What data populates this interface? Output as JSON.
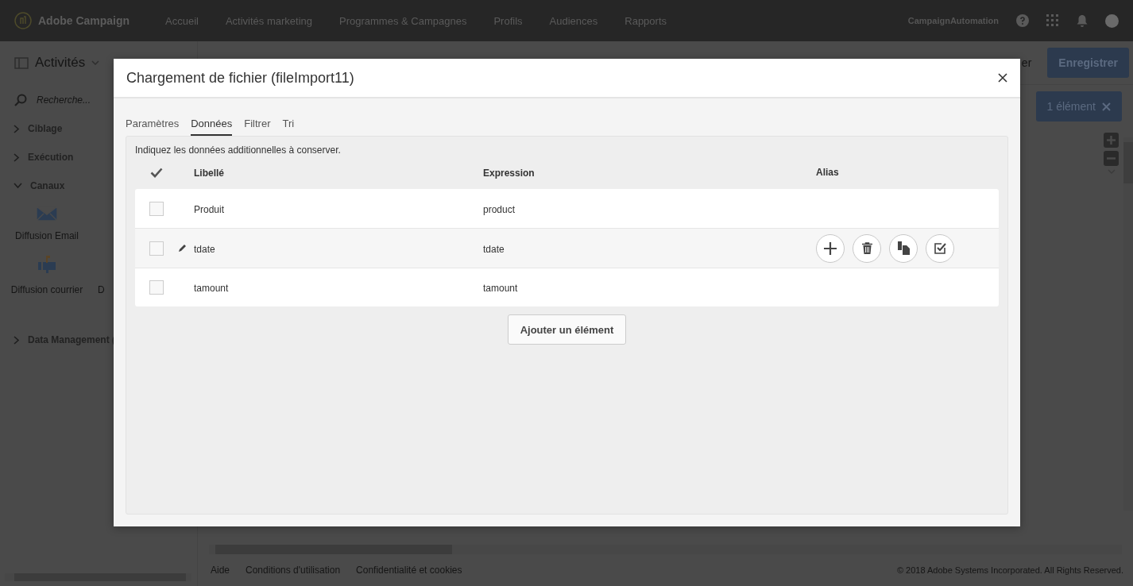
{
  "topbar": {
    "brand": "Adobe Campaign",
    "nav": [
      "Accueil",
      "Activités marketing",
      "Programmes & Campagnes",
      "Profils",
      "Audiences",
      "Rapports"
    ],
    "user": "CampaignAutomation"
  },
  "toolbar": {
    "title": "Activités",
    "cancel_fragment": "er",
    "save": "Enregistrer",
    "selection": "1 élément"
  },
  "sidebar": {
    "search_placeholder": "Recherche...",
    "sections": [
      {
        "label": "Ciblage",
        "expanded": false
      },
      {
        "label": "Exécution",
        "expanded": false
      },
      {
        "label": "Canaux",
        "expanded": true,
        "items": [
          {
            "label": "Diffusion Email",
            "kind": "email"
          },
          {
            "label": "Diffusion courrier",
            "kind": "mail"
          },
          {
            "label": "D",
            "kind": "cut"
          }
        ]
      },
      {
        "label": "Data Management (",
        "expanded": false
      }
    ]
  },
  "dialog": {
    "title": "Chargement de fichier (fileImport11)",
    "tabs": [
      {
        "label": "Paramètres",
        "selected": false
      },
      {
        "label": "Données",
        "selected": true
      },
      {
        "label": "Filtrer",
        "selected": false
      },
      {
        "label": "Tri",
        "selected": false
      }
    ],
    "description": "Indiquez les données additionnelles à conserver.",
    "columns": [
      "Libellé",
      "Expression",
      "Alias"
    ],
    "rows": [
      {
        "label": "Produit",
        "expression": "product",
        "checked": false,
        "active": false
      },
      {
        "label": "tdate",
        "expression": "tdate",
        "checked": false,
        "active": true
      },
      {
        "label": "tamount",
        "expression": "tamount",
        "checked": false,
        "active": false
      }
    ],
    "add_button": "Ajouter un élément"
  },
  "footer": {
    "links": [
      "Aide",
      "Conditions d'utilisation",
      "Confidentialité et cookies"
    ],
    "copyright": "© 2018 Adobe Systems Incorporated. All Rights Reserved."
  }
}
